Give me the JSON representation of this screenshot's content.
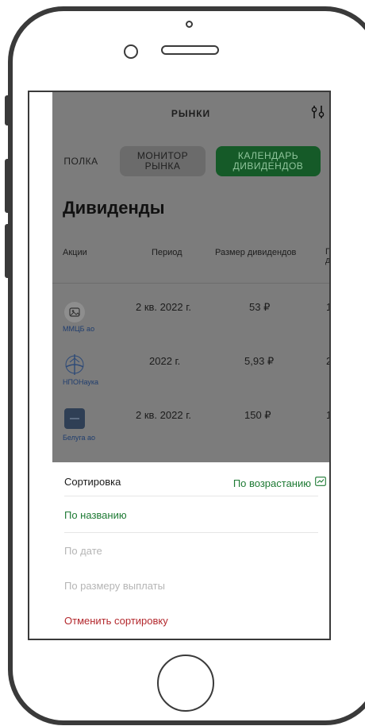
{
  "header": {
    "title": "РЫНКИ",
    "filter_icon": "filter-sliders-icon"
  },
  "tabs": [
    {
      "label": "ПОЛКА"
    },
    {
      "label": "МОНИТОР РЫНКА"
    },
    {
      "label": "КАЛЕНДАРЬ ДИВИДЕНДОВ",
      "active": true
    }
  ],
  "section_title": "Дивиденды",
  "table": {
    "columns": [
      "Акции",
      "Период",
      "Размер дивидендов",
      "П д"
    ],
    "rows": [
      {
        "logo_label": "ММЦБ ао",
        "period": "2 кв. 2022 г.",
        "amount": "53 ₽",
        "extra": "1"
      },
      {
        "logo_label": "НПОНаука",
        "period": "2022 г.",
        "amount": "5,93 ₽",
        "extra": "2"
      },
      {
        "logo_label": "Белуга ао",
        "period": "2 кв. 2022 г.",
        "amount": "150 ₽",
        "extra": "1"
      }
    ]
  },
  "sort_sheet": {
    "title": "Сортировка",
    "current": "По возрастанию",
    "current_icon": "ascending-chart-icon",
    "options": [
      {
        "label": "По названию",
        "state": "selected"
      },
      {
        "label": "По дате",
        "state": "disabled"
      },
      {
        "label": "По размеру выплаты",
        "state": "disabled"
      }
    ],
    "cancel": "Отменить сортировку"
  },
  "colors": {
    "accent_green": "#1e7a34",
    "active_tab_bg": "#155a28",
    "cancel_red": "#b3282d"
  }
}
